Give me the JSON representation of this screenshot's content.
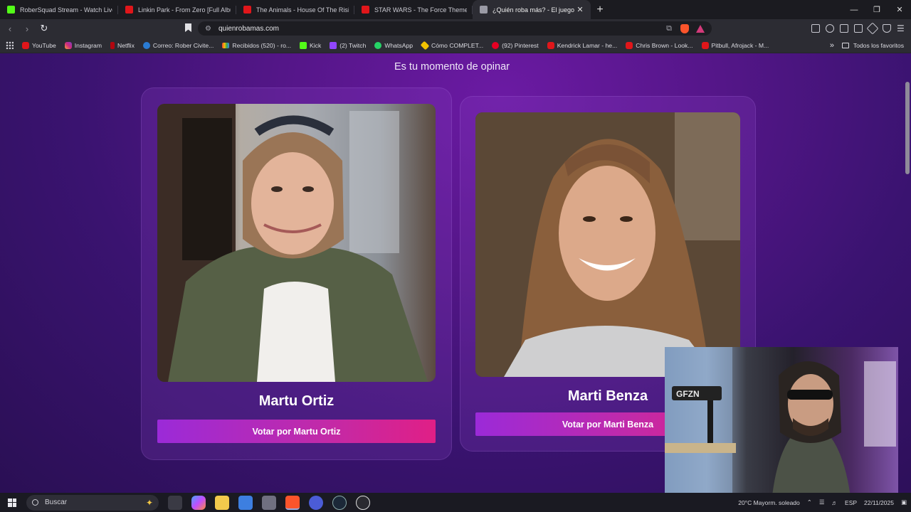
{
  "browser": {
    "tabs": [
      {
        "title": "RoberSquad Stream - Watch Live",
        "icon": "kick-icon",
        "color": "#53fc18",
        "active": false
      },
      {
        "title": "Linkin Park - From Zero [Full Albu",
        "icon": "youtube-icon",
        "color": "#e0161a",
        "active": false
      },
      {
        "title": "The Animals - House Of The Rising S",
        "icon": "youtube-icon",
        "color": "#e0161a",
        "active": false
      },
      {
        "title": "STAR WARS - The Force Theme - Emp",
        "icon": "youtube-icon",
        "color": "#e0161a",
        "active": false
      },
      {
        "title": "¿Quién roba más? - El juego que",
        "icon": "site-icon",
        "color": "#9a9aa5",
        "active": true
      }
    ],
    "new_tab": "+",
    "url": "quienrobamas.com",
    "bookmarks": [
      {
        "label": "YouTube",
        "icon": "yt"
      },
      {
        "label": "Instagram",
        "icon": "ig"
      },
      {
        "label": "Netflix",
        "icon": "nf"
      },
      {
        "label": "Correo: Rober Civite...",
        "icon": "ol"
      },
      {
        "label": "Recibidos (520) - ro...",
        "icon": "gm"
      },
      {
        "label": "Kick",
        "icon": "kk"
      },
      {
        "label": "(2) Twitch",
        "icon": "tw"
      },
      {
        "label": "WhatsApp",
        "icon": "wa"
      },
      {
        "label": "Cómo COMPLET...",
        "icon": "gd"
      },
      {
        "label": "(92) Pinterest",
        "icon": "pt"
      },
      {
        "label": "Kendrick Lamar - he...",
        "icon": "yt"
      },
      {
        "label": "Chris Brown - Look...",
        "icon": "yt"
      },
      {
        "label": "Pitbull, Afrojack - M...",
        "icon": "yt"
      }
    ],
    "bookmarks_more": "»",
    "all_favorites": "Todos los favoritos"
  },
  "page": {
    "headline": "Es tu momento de opinar",
    "candidates": [
      {
        "name": "Martu Ortiz",
        "vote_label": "Votar por Martu Ortiz"
      },
      {
        "name": "Marti Benza",
        "vote_label": "Votar por Marti Benza"
      }
    ]
  },
  "webcam": {
    "mic_label": "GFZN"
  },
  "taskbar": {
    "search_placeholder": "Buscar",
    "weather": "20°C  Mayorm. soleado",
    "lang": "ESP",
    "date": "22/11/2025"
  }
}
